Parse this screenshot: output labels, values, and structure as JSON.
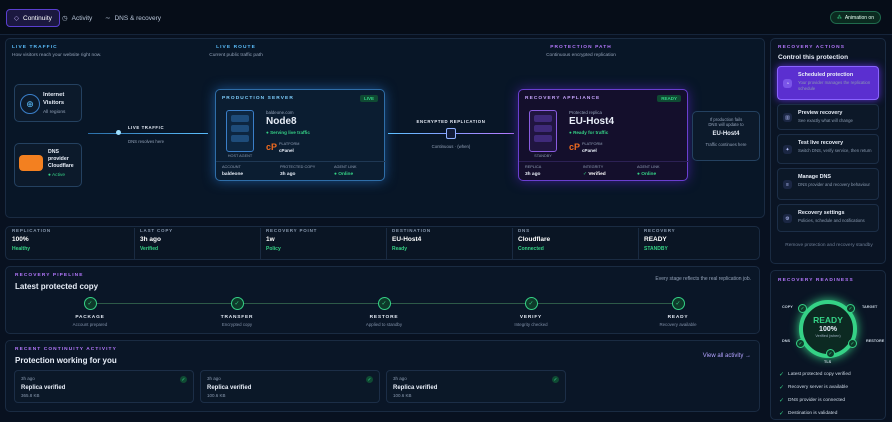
{
  "tabs": [
    {
      "label": "Continuity"
    },
    {
      "label": "Activity"
    },
    {
      "label": "DNS & recovery"
    }
  ],
  "animation_toggle": "Animation on",
  "live_traffic": {
    "heading": "LIVE TRAFFIC",
    "desc": "How visitors reach your website right now."
  },
  "live_route": {
    "heading": "LIVE ROUTE",
    "desc": "Current public traffic path"
  },
  "protection_path": {
    "heading": "PROTECTION PATH",
    "desc": "Continuous encrypted replication"
  },
  "internet_node": {
    "title": "Internet",
    "title2": "Visitors",
    "sub": "All regions"
  },
  "dns_node": {
    "title": "DNS",
    "title2": "provider",
    "name": "Cloudflare",
    "status": "Active"
  },
  "traffic_link": {
    "label": "LIVE TRAFFIC",
    "sub": "DNS resolves here"
  },
  "production": {
    "heading": "PRODUCTION SERVER",
    "badge": "LIVE",
    "host_label": "baldeone.com",
    "host": "Node8",
    "status": "Serving live traffic",
    "platform_label": "PLATFORM",
    "platform": "cPanel",
    "rack_label": "HOST AGENT",
    "f1_k": "ACCOUNT",
    "f1_v": "baldeone",
    "f2_k": "PROTECTED COPY",
    "f2_v": "3h ago",
    "f3_k": "AGENT LINK",
    "f3_v": "Online"
  },
  "encrypted": {
    "label": "ENCRYPTED REPLICATION",
    "sub": "Continuous · (when)"
  },
  "appliance": {
    "heading": "RECOVERY APPLIANCE",
    "badge": "READY",
    "host_label": "Protected replica",
    "host": "EU-Host4",
    "status": "Ready for traffic",
    "platform_label": "PLATFORM",
    "platform": "cPanel",
    "rack_label": "STANDBY",
    "f1_k": "REPLICA",
    "f1_v": "3h ago",
    "f2_k": "INTEGRITY",
    "f2_v": "Verified",
    "f3_k": "AGENT LINK",
    "f3_v": "Online"
  },
  "failover": {
    "line1": "If production fails",
    "line2": "DNS will update to",
    "target": "EU-Host4",
    "note": "Traffic continues here"
  },
  "metrics": [
    {
      "k": "REPLICATION",
      "v": "100%",
      "s": "Healthy"
    },
    {
      "k": "LAST COPY",
      "v": "3h ago",
      "s": "Verified"
    },
    {
      "k": "RECOVERY POINT",
      "v": "1w",
      "s": "Policy"
    },
    {
      "k": "DESTINATION",
      "v": "EU-Host4",
      "s": "Ready"
    },
    {
      "k": "DNS",
      "v": "Cloudflare",
      "s": "Connected"
    },
    {
      "k": "RECOVERY",
      "v": "READY",
      "s": "STANDBY"
    }
  ],
  "pipeline": {
    "heading": "RECOVERY PIPELINE",
    "title": "Latest protected copy",
    "note": "Every stage reflects the real replication job.",
    "steps": [
      {
        "n": "PACKAGE",
        "d": "Account prepared"
      },
      {
        "n": "TRANSFER",
        "d": "Encrypted copy"
      },
      {
        "n": "RESTORE",
        "d": "Applied to standby"
      },
      {
        "n": "VERIFY",
        "d": "Integrity checked"
      },
      {
        "n": "READY",
        "d": "Recovery available"
      }
    ]
  },
  "recent": {
    "heading": "RECENT CONTINUITY ACTIVITY",
    "title": "Protection working for you",
    "view_all": "View all activity →",
    "items": [
      {
        "a": "3h ago",
        "b": "Replica verified",
        "c": "365.8 KB"
      },
      {
        "a": "3h ago",
        "b": "Replica verified",
        "c": "100.6 KB"
      },
      {
        "a": "3h ago",
        "b": "Replica verified",
        "c": "100.6 KB"
      }
    ]
  },
  "actions": {
    "heading": "RECOVERY ACTIONS",
    "title": "Control this protection",
    "items": [
      {
        "t": "Scheduled protection",
        "d": "Your provider manages the replication schedule"
      },
      {
        "t": "Preview recovery",
        "d": "See exactly what will change"
      },
      {
        "t": "Test live recovery",
        "d": "Switch DNS, verify service, then return"
      },
      {
        "t": "Manage DNS",
        "d": "DNS provider and recovery behaviour"
      },
      {
        "t": "Recovery settings",
        "d": "Policies, schedule and notifications"
      }
    ],
    "remove": "Remove protection and recovery standby"
  },
  "readiness": {
    "heading": "RECOVERY READINESS",
    "state": "READY",
    "pct": "100%",
    "sub": "Verified (when)",
    "points": [
      "COPY",
      "TARGET",
      "DNS",
      "RESTORE",
      "TLS"
    ],
    "checks": [
      "Latest protected copy verified",
      "Recovery server is available",
      "DNS provider is connected",
      "Destination is validated"
    ]
  },
  "colors": {
    "accent": "#7b4dff",
    "green": "#35d286",
    "blue": "#5cc0ff",
    "purple": "#b678ff"
  }
}
